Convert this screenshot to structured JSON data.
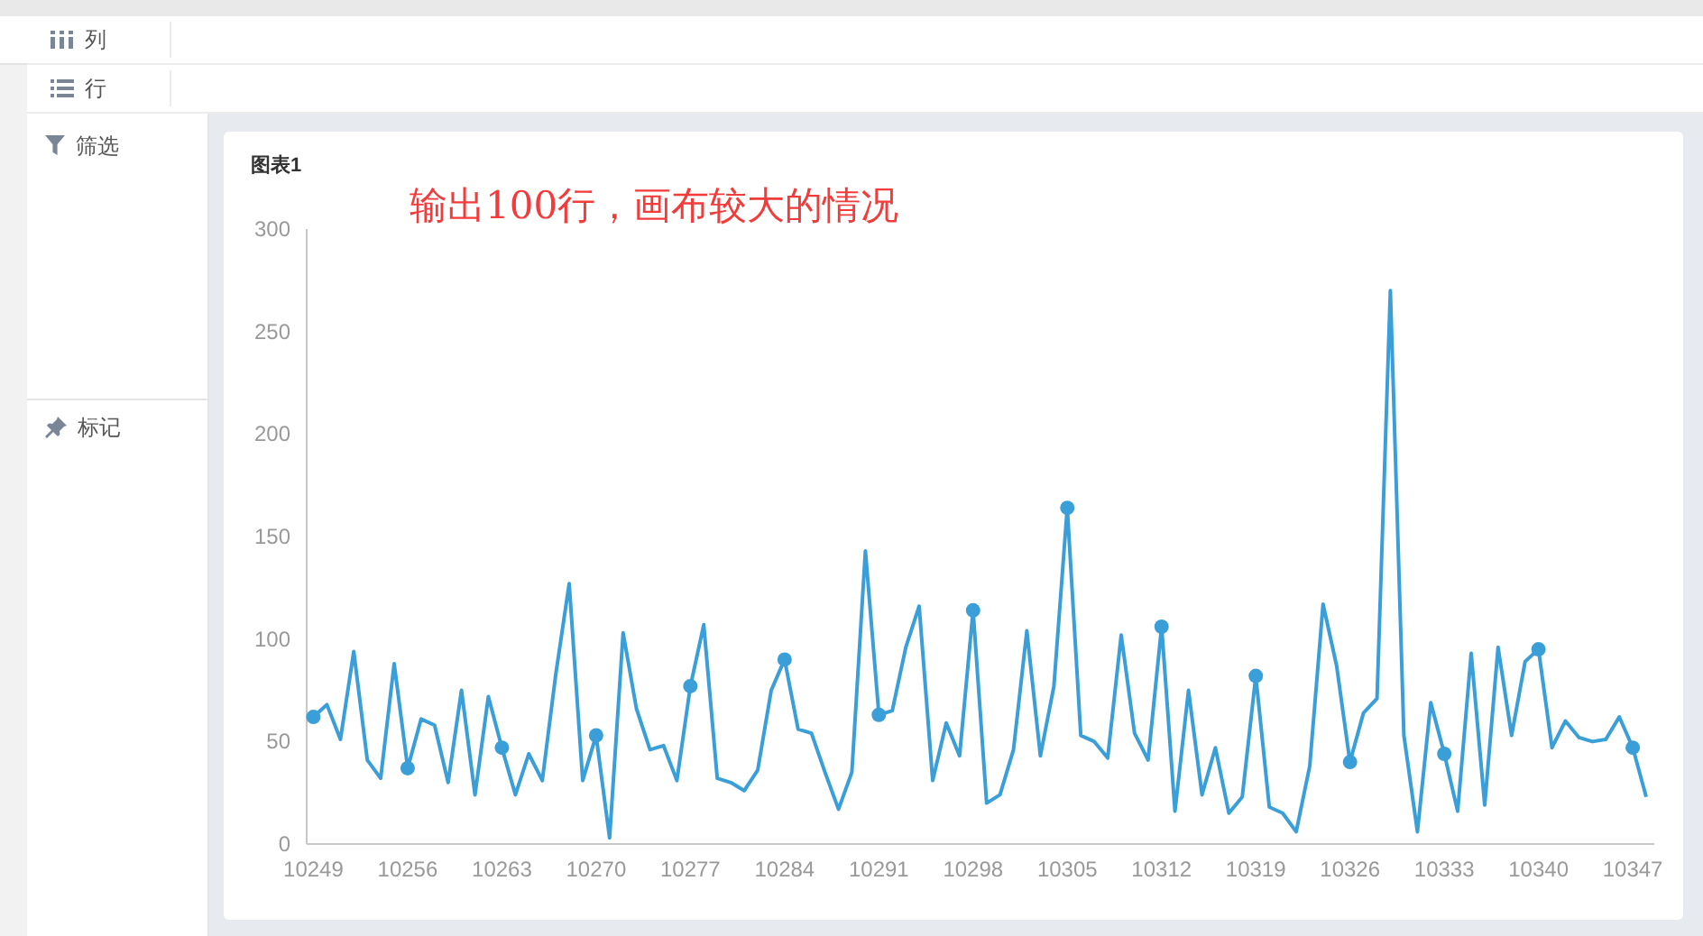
{
  "shelves": [
    {
      "kind": "columns",
      "label": "列"
    },
    {
      "kind": "rows",
      "label": "行"
    }
  ],
  "side_panels": [
    {
      "kind": "filter",
      "label": "筛选"
    },
    {
      "kind": "marks",
      "label": "标记"
    }
  ],
  "card": {
    "title": "图表1",
    "note": "输出100行，画布较大的情况",
    "chart_data": {
      "type": "line",
      "x": [
        10249,
        10250,
        10251,
        10252,
        10253,
        10254,
        10255,
        10256,
        10257,
        10258,
        10259,
        10260,
        10261,
        10262,
        10263,
        10264,
        10265,
        10266,
        10267,
        10268,
        10269,
        10270,
        10271,
        10272,
        10273,
        10274,
        10275,
        10276,
        10277,
        10278,
        10279,
        10280,
        10281,
        10282,
        10283,
        10284,
        10285,
        10286,
        10287,
        10288,
        10289,
        10290,
        10291,
        10292,
        10293,
        10294,
        10295,
        10296,
        10297,
        10298,
        10299,
        10300,
        10301,
        10302,
        10303,
        10304,
        10305,
        10306,
        10307,
        10308,
        10309,
        10310,
        10311,
        10312,
        10313,
        10314,
        10315,
        10316,
        10317,
        10318,
        10319,
        10320,
        10321,
        10322,
        10323,
        10324,
        10325,
        10326,
        10327,
        10328,
        10329,
        10330,
        10331,
        10332,
        10333,
        10334,
        10335,
        10336,
        10337,
        10338,
        10339,
        10340,
        10341,
        10342,
        10343,
        10344,
        10345,
        10346,
        10347,
        10348
      ],
      "xlim": [
        10248.5,
        10348.6
      ],
      "series": [
        {
          "color": "#3a9fd8",
          "values": [
            62,
            68,
            51,
            94,
            41,
            32,
            88,
            37,
            61,
            58,
            30,
            75,
            24,
            72,
            47,
            24,
            44,
            31,
            83,
            127,
            31,
            53,
            3,
            103,
            66,
            46,
            48,
            31,
            77,
            107,
            32,
            30,
            26,
            36,
            75,
            90,
            56,
            54,
            35,
            17,
            35,
            143,
            63,
            65,
            96,
            116,
            31,
            59,
            43,
            114,
            20,
            24,
            46,
            104,
            43,
            77,
            164,
            53,
            50,
            42,
            102,
            54,
            41,
            106,
            16,
            75,
            24,
            47,
            15,
            23,
            82,
            18,
            15,
            6,
            38,
            117,
            87,
            40,
            64,
            71,
            270,
            53,
            6,
            69,
            44,
            16,
            93,
            19,
            96,
            53,
            89,
            95,
            47,
            60,
            52,
            50,
            51,
            62,
            47,
            23
          ]
        }
      ],
      "ylim": [
        0,
        300
      ],
      "yticks": [
        0,
        50,
        100,
        150,
        200,
        250,
        300
      ],
      "xticks": [
        10249,
        10256,
        10263,
        10270,
        10277,
        10284,
        10291,
        10298,
        10305,
        10312,
        10319,
        10326,
        10333,
        10340,
        10347
      ]
    }
  }
}
